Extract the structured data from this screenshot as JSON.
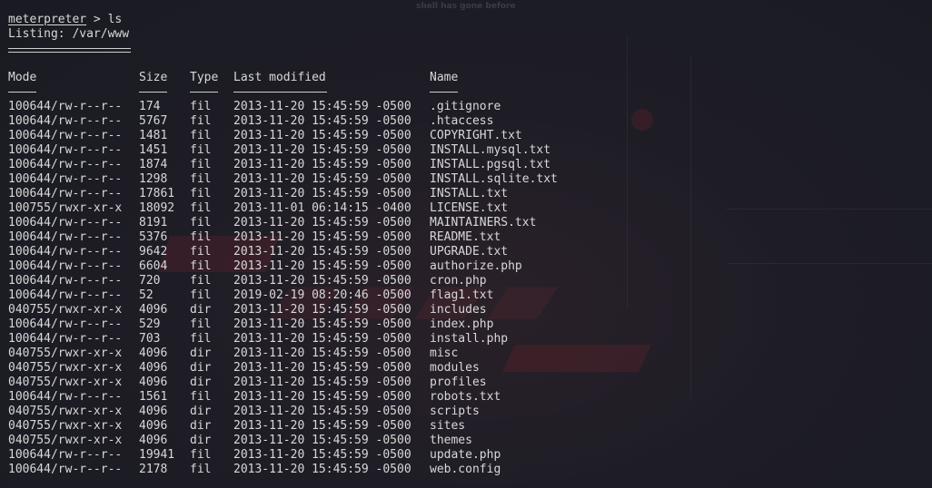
{
  "terminal": {
    "prompt": "meterpreter",
    "command": " > ls",
    "listing_line": "Listing: /var/www",
    "bg_watermark_top": "shell has gone before"
  },
  "columns": {
    "mode": "Mode",
    "size": "Size",
    "type": "Type",
    "last_modified": "Last modified",
    "name": "Name"
  },
  "files": [
    {
      "mode": "100644/rw-r--r--",
      "size": "174",
      "type": "fil",
      "modified": "2013-11-20 15:45:59 -0500",
      "name": ".gitignore"
    },
    {
      "mode": "100644/rw-r--r--",
      "size": "5767",
      "type": "fil",
      "modified": "2013-11-20 15:45:59 -0500",
      "name": ".htaccess"
    },
    {
      "mode": "100644/rw-r--r--",
      "size": "1481",
      "type": "fil",
      "modified": "2013-11-20 15:45:59 -0500",
      "name": "COPYRIGHT.txt"
    },
    {
      "mode": "100644/rw-r--r--",
      "size": "1451",
      "type": "fil",
      "modified": "2013-11-20 15:45:59 -0500",
      "name": "INSTALL.mysql.txt"
    },
    {
      "mode": "100644/rw-r--r--",
      "size": "1874",
      "type": "fil",
      "modified": "2013-11-20 15:45:59 -0500",
      "name": "INSTALL.pgsql.txt"
    },
    {
      "mode": "100644/rw-r--r--",
      "size": "1298",
      "type": "fil",
      "modified": "2013-11-20 15:45:59 -0500",
      "name": "INSTALL.sqlite.txt"
    },
    {
      "mode": "100644/rw-r--r--",
      "size": "17861",
      "type": "fil",
      "modified": "2013-11-20 15:45:59 -0500",
      "name": "INSTALL.txt"
    },
    {
      "mode": "100755/rwxr-xr-x",
      "size": "18092",
      "type": "fil",
      "modified": "2013-11-01 06:14:15 -0400",
      "name": "LICENSE.txt"
    },
    {
      "mode": "100644/rw-r--r--",
      "size": "8191",
      "type": "fil",
      "modified": "2013-11-20 15:45:59 -0500",
      "name": "MAINTAINERS.txt"
    },
    {
      "mode": "100644/rw-r--r--",
      "size": "5376",
      "type": "fil",
      "modified": "2013-11-20 15:45:59 -0500",
      "name": "README.txt"
    },
    {
      "mode": "100644/rw-r--r--",
      "size": "9642",
      "type": "fil",
      "modified": "2013-11-20 15:45:59 -0500",
      "name": "UPGRADE.txt"
    },
    {
      "mode": "100644/rw-r--r--",
      "size": "6604",
      "type": "fil",
      "modified": "2013-11-20 15:45:59 -0500",
      "name": "authorize.php"
    },
    {
      "mode": "100644/rw-r--r--",
      "size": "720",
      "type": "fil",
      "modified": "2013-11-20 15:45:59 -0500",
      "name": "cron.php"
    },
    {
      "mode": "100644/rw-r--r--",
      "size": "52",
      "type": "fil",
      "modified": "2019-02-19 08:20:46 -0500",
      "name": "flag1.txt"
    },
    {
      "mode": "040755/rwxr-xr-x",
      "size": "4096",
      "type": "dir",
      "modified": "2013-11-20 15:45:59 -0500",
      "name": "includes"
    },
    {
      "mode": "100644/rw-r--r--",
      "size": "529",
      "type": "fil",
      "modified": "2013-11-20 15:45:59 -0500",
      "name": "index.php"
    },
    {
      "mode": "100644/rw-r--r--",
      "size": "703",
      "type": "fil",
      "modified": "2013-11-20 15:45:59 -0500",
      "name": "install.php"
    },
    {
      "mode": "040755/rwxr-xr-x",
      "size": "4096",
      "type": "dir",
      "modified": "2013-11-20 15:45:59 -0500",
      "name": "misc"
    },
    {
      "mode": "040755/rwxr-xr-x",
      "size": "4096",
      "type": "dir",
      "modified": "2013-11-20 15:45:59 -0500",
      "name": "modules"
    },
    {
      "mode": "040755/rwxr-xr-x",
      "size": "4096",
      "type": "dir",
      "modified": "2013-11-20 15:45:59 -0500",
      "name": "profiles"
    },
    {
      "mode": "100644/rw-r--r--",
      "size": "1561",
      "type": "fil",
      "modified": "2013-11-20 15:45:59 -0500",
      "name": "robots.txt"
    },
    {
      "mode": "040755/rwxr-xr-x",
      "size": "4096",
      "type": "dir",
      "modified": "2013-11-20 15:45:59 -0500",
      "name": "scripts"
    },
    {
      "mode": "040755/rwxr-xr-x",
      "size": "4096",
      "type": "dir",
      "modified": "2013-11-20 15:45:59 -0500",
      "name": "sites"
    },
    {
      "mode": "040755/rwxr-xr-x",
      "size": "4096",
      "type": "dir",
      "modified": "2013-11-20 15:45:59 -0500",
      "name": "themes"
    },
    {
      "mode": "100644/rw-r--r--",
      "size": "19941",
      "type": "fil",
      "modified": "2013-11-20 15:45:59 -0500",
      "name": "update.php"
    },
    {
      "mode": "100644/rw-r--r--",
      "size": "2178",
      "type": "fil",
      "modified": "2013-11-20 15:45:59 -0500",
      "name": "web.config"
    }
  ],
  "colors": {
    "background": "#1b1c24",
    "text": "#d8d8d8"
  }
}
